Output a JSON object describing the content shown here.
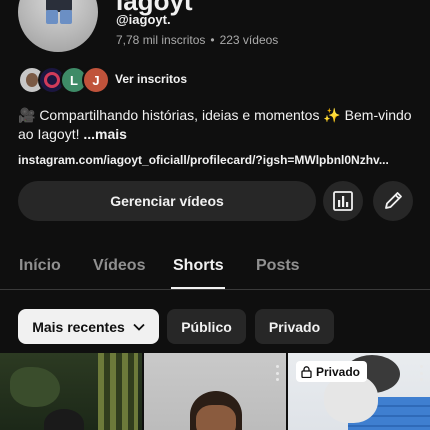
{
  "channel": {
    "name": "Iagoyt",
    "handle": "@iagoyt.",
    "subscribers": "7,78 mil inscritos",
    "separator": "•",
    "videos": "223 vídeos",
    "see_subscribers": "Ver inscritos",
    "bio": "🎥 Compartilhando histórias, ideias e momentos ✨ Bem-vindo ao Iagoyt!",
    "bio_more": "...mais",
    "link": "instagram.com/iagoyt_oficiall/profilecard/?igsh=MWlpbnl0Nzhv..."
  },
  "subscriber_avatars": [
    {
      "icon": "person-photo",
      "letter": ""
    },
    {
      "icon": "logo-ring",
      "letter": ""
    },
    {
      "icon": "letter",
      "letter": "L"
    },
    {
      "icon": "letter",
      "letter": "J"
    }
  ],
  "actions": {
    "manage_label": "Gerenciar vídeos",
    "stats_icon": "bar-chart-icon",
    "edit_icon": "pencil-icon"
  },
  "tabs": [
    {
      "label": "Início",
      "active": false
    },
    {
      "label": "Vídeos",
      "active": false
    },
    {
      "label": "Shorts",
      "active": true
    },
    {
      "label": "Posts",
      "active": false
    }
  ],
  "filters": {
    "sort_label": "Mais recentes",
    "public_label": "Público",
    "private_label": "Privado"
  },
  "shorts": [
    {
      "badge": ""
    },
    {
      "badge": ""
    },
    {
      "badge": "Privado"
    }
  ],
  "colors": {
    "background": "#0f0f0f",
    "surface": "#272727",
    "text": "#f1f1f1",
    "muted": "#aaaaaa",
    "chip_active": "#f1f1f1"
  }
}
